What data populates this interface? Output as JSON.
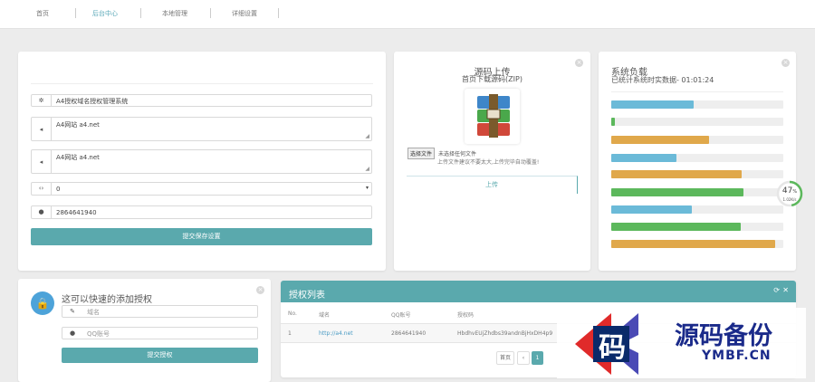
{
  "nav": {
    "items": [
      "首页",
      "后台中心",
      "本地管理",
      "详细设置"
    ],
    "active_index": 1
  },
  "form_card": {
    "site_name": "A4授权域名授权管理系统",
    "notice1": "A4网站 a4.net",
    "notice2": "A4网站 a4.net",
    "select_value": "0",
    "qq": "2864641940",
    "submit_label": "提交保存设置"
  },
  "upload": {
    "title": "源码上传",
    "subtitle": "首页下载源码(ZIP)",
    "choose_file": "选择文件",
    "no_file": "未选择任何文件",
    "hint": "上传文件建议不要太大,上传完毕自动覆盖!",
    "upload_label": "上传"
  },
  "load": {
    "title": "系统负载",
    "uptime": "已统计系统时实数据- 01:01:24",
    "percent_text": "47",
    "percent_unit": "%",
    "speed": "1.02K/s",
    "gauge_level": 0.47,
    "bars": [
      {
        "fill": 0.48,
        "color": "#6bbad8"
      },
      {
        "fill": 0.02,
        "color": "#5cb85c"
      },
      {
        "fill": 0.57,
        "color": "#e0a84b"
      },
      {
        "fill": 0.38,
        "color": "#6bbad8"
      },
      {
        "fill": 0.76,
        "color": "#e0a84b"
      },
      {
        "fill": 0.77,
        "color": "#5cb85c"
      },
      {
        "fill": 0.47,
        "color": "#6bbad8"
      },
      {
        "fill": 0.75,
        "color": "#5cb85c"
      },
      {
        "fill": 0.95,
        "color": "#e0a84b"
      }
    ]
  },
  "quick_add": {
    "title": "这可以快速的添加授权",
    "domain_placeholder": "域名",
    "qq_placeholder": "QQ账号",
    "submit_label": "提交授权"
  },
  "table": {
    "title": "授权列表",
    "headers": [
      "No.",
      "域名",
      "QQ账号",
      "授权码"
    ],
    "rows": [
      [
        "1",
        "http://a4.net",
        "2864641940",
        "HbdhvEUjZhdbs39andnBjHxDH4p9"
      ]
    ],
    "pagination": [
      "首页",
      "‹",
      "1"
    ]
  },
  "watermark": {
    "cn": "源码备份",
    "en": "YMBF.CN",
    "glyph": "码"
  }
}
